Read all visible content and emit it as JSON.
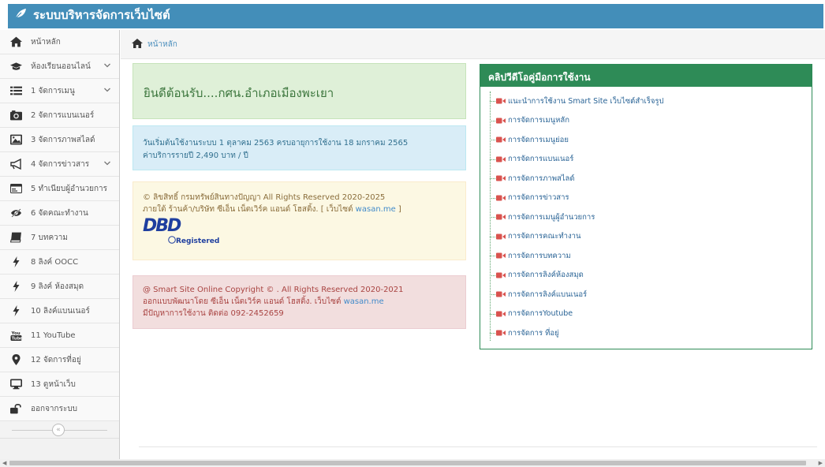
{
  "brand": {
    "title": "ระบบบริหารจัดการเว็บไซต์",
    "icon": "leaf-icon"
  },
  "sidebar": {
    "items": [
      {
        "label": "หน้าหลัก",
        "icon": "home-icon",
        "chevron": false
      },
      {
        "label": "ห้องเรียนออนไลน์",
        "icon": "graduation-cap-icon",
        "chevron": true
      },
      {
        "label": "1 จัดการเมนู",
        "icon": "list-icon",
        "chevron": true
      },
      {
        "label": "2 จัดการแบนเนอร์",
        "icon": "camera-icon",
        "chevron": false
      },
      {
        "label": "3 จัดการภาพสไลด์",
        "icon": "image-icon",
        "chevron": false
      },
      {
        "label": "4 จัดการข่าวสาร",
        "icon": "bullhorn-icon",
        "chevron": true
      },
      {
        "label": "5 ทำเนียบผู้อำนวยการ",
        "icon": "id-card-icon",
        "chevron": false
      },
      {
        "label": "6 จัดคณะทำงาน",
        "icon": "eye-slash-icon",
        "chevron": false
      },
      {
        "label": "7 บทความ",
        "icon": "book-icon",
        "chevron": false
      },
      {
        "label": "8 ลิงค์ OOCC",
        "icon": "flash-icon",
        "chevron": false
      },
      {
        "label": "9 ลิงค์ ห้องสมุด",
        "icon": "flash-icon",
        "chevron": false
      },
      {
        "label": "10 ลิงค์แบนเนอร์",
        "icon": "flash-icon",
        "chevron": false
      },
      {
        "label": "11 YouTube",
        "icon": "youtube-icon",
        "chevron": false
      },
      {
        "label": "12 จัดการที่อยู่",
        "icon": "map-marker-icon",
        "chevron": false
      },
      {
        "label": "13 ดูหน้าเว็บ",
        "icon": "desktop-icon",
        "chevron": false
      },
      {
        "label": "ออกจากระบบ",
        "icon": "unlock-icon",
        "chevron": false
      }
    ],
    "collapse_glyph": "«"
  },
  "breadcrumb": {
    "label": "หน้าหลัก"
  },
  "welcome": {
    "text": "ยินดีต้อนรับ....กศน.อำเภอเมืองพะเยา"
  },
  "info": {
    "line1": "วันเริ่มต้นใช้งานระบบ 1 ตุลาคม 2563 ครบอายุการใช้งาน 18 มกราคม 2565",
    "line2": "ค่าบริการรายปี 2,490 บาท / ปี"
  },
  "copyright": {
    "line1": "© ลิขสิทธิ์ กรมทรัพย์สินทางปัญญา All Rights Reserved 2020-2025",
    "line2_prefix": "ภายใต้ ร้านค้า/บริษัท ซีเอ็น เน็ตเวิร์ค แอนด์ โฮสติ้ง. [ เว็บไซต์ ",
    "line2_link": "wasan.me",
    "line2_suffix": " ]",
    "dbd_logo": "DBD",
    "dbd_registered": "Registered"
  },
  "smartsite": {
    "line1": "@ Smart Site Online Copyright © . All Rights Reserved 2020-2021",
    "line2_prefix": "ออกแบบพัฒนาโดย ซีเอ็น เน็ตเวิร์ค แอนด์ โฮสติ้ง. เว็บไซต์ ",
    "line2_link": "wasan.me",
    "line3": "มีปัญหาการใช้งาน ติดต่อ 092-2452659"
  },
  "videos": {
    "title": "คลิปวีดีโอคู่มือการใช้งาน",
    "items": [
      "แนะนำการใช้งาน Smart Site เว็บไซต์สำเร็จรูป",
      "การจัดการเมนูหลัก",
      "การจัดการเมนูย่อย",
      "การจัดการแบนเนอร์",
      "การจัดการภาพสไลด์",
      "การจัดการข่าวสาร",
      "การจัดการเมนูผู้อำนวยการ",
      "การจัดการคณะทำงาน",
      "การจัดการบทความ",
      "การจัดการลิงค์ห้องสมุด",
      "การจัดการลิงค์แบนเนอร์",
      "การจัดการYoutube",
      "การจัดการ ที่อยู่"
    ]
  },
  "colors": {
    "navbar": "#438eb9",
    "video_header": "#2e8b57",
    "camera": "#d9534f"
  }
}
